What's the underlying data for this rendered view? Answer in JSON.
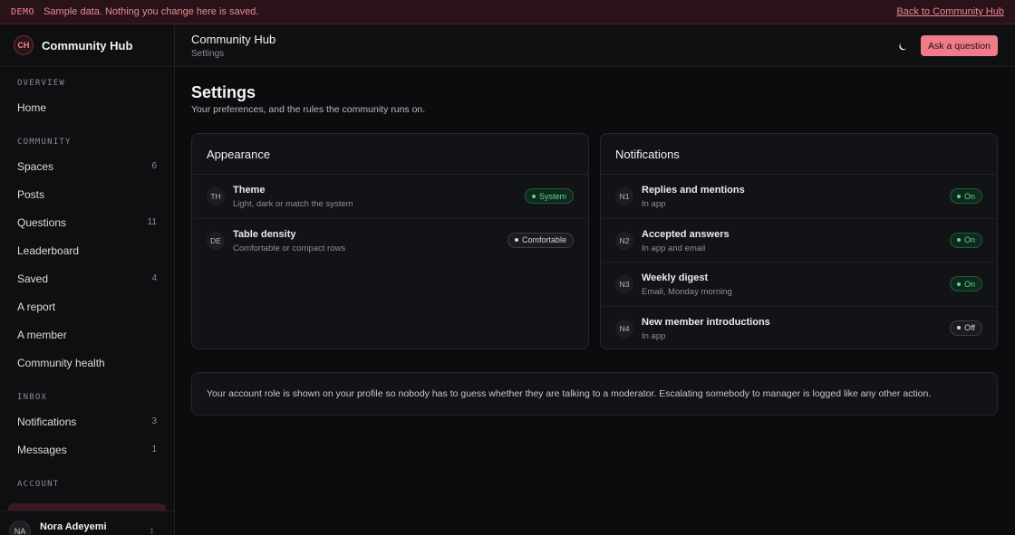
{
  "banner": {
    "tag": "DEMO",
    "text": "Sample data. Nothing you change here is saved.",
    "link": "Back to Community Hub"
  },
  "brand": {
    "initials": "CH",
    "name": "Community Hub"
  },
  "sidebar": {
    "sections": [
      {
        "label": "OVERVIEW",
        "items": [
          {
            "label": "Home",
            "count": ""
          }
        ]
      },
      {
        "label": "COMMUNITY",
        "items": [
          {
            "label": "Spaces",
            "count": "6"
          },
          {
            "label": "Posts",
            "count": ""
          },
          {
            "label": "Questions",
            "count": "11"
          },
          {
            "label": "Leaderboard",
            "count": ""
          },
          {
            "label": "Saved",
            "count": "4"
          },
          {
            "label": "A report",
            "count": ""
          },
          {
            "label": "A member",
            "count": ""
          },
          {
            "label": "Community health",
            "count": ""
          }
        ]
      },
      {
        "label": "INBOX",
        "items": [
          {
            "label": "Notifications",
            "count": "3"
          },
          {
            "label": "Messages",
            "count": "1"
          }
        ]
      },
      {
        "label": "ACCOUNT",
        "items": []
      }
    ],
    "user": {
      "initials": "NA",
      "name": "Nora Adeyemi"
    }
  },
  "header": {
    "title": "Community Hub",
    "crumb": "Settings",
    "theme_icon": "moon-icon",
    "ask_label": "Ask a question"
  },
  "page": {
    "title": "Settings",
    "subtitle": "Your preferences, and the rules the community runs on."
  },
  "appearance": {
    "title": "Appearance",
    "rows": [
      {
        "code": "TH",
        "title": "Theme",
        "desc": "Light, dark or match the system",
        "value": "System",
        "tone": "green"
      },
      {
        "code": "DE",
        "title": "Table density",
        "desc": "Comfortable or compact rows",
        "value": "Comfortable",
        "tone": "gray"
      }
    ]
  },
  "notifications": {
    "title": "Notifications",
    "rows": [
      {
        "code": "N1",
        "title": "Replies and mentions",
        "desc": "In app",
        "value": "On",
        "tone": "green"
      },
      {
        "code": "N2",
        "title": "Accepted answers",
        "desc": "In app and email",
        "value": "On",
        "tone": "green"
      },
      {
        "code": "N3",
        "title": "Weekly digest",
        "desc": "Email, Monday morning",
        "value": "On",
        "tone": "green"
      },
      {
        "code": "N4",
        "title": "New member introductions",
        "desc": "In app",
        "value": "Off",
        "tone": "gray"
      }
    ]
  },
  "note": "Your account role is shown on your profile so nobody has to guess whether they are talking to a moderator. Escalating somebody to manager is logged like any other action.",
  "colors": {
    "accent": "#f07c8a",
    "on": "#5fd69a",
    "background": "#0b0c0e"
  }
}
